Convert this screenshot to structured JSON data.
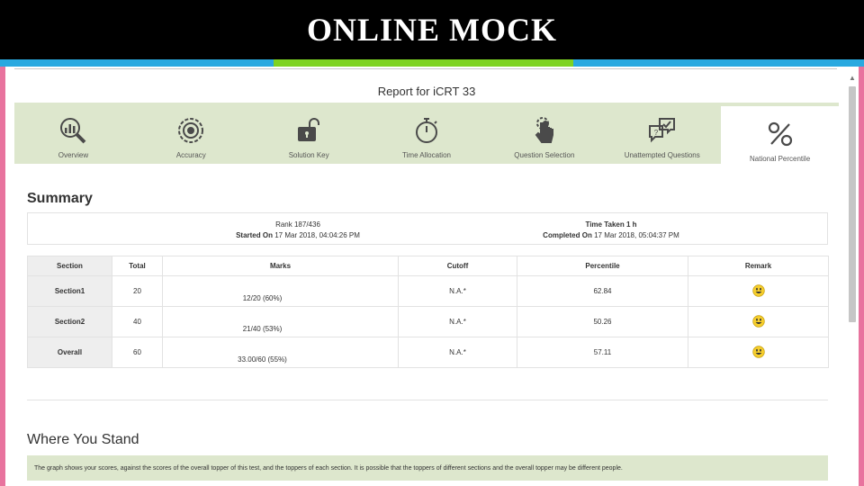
{
  "banner": {
    "title": "ONLINE MOCK"
  },
  "accent_colors": [
    "#29a9e0",
    "#29a9e0",
    "#7ed321",
    "#29a9e0"
  ],
  "report": {
    "title": "Report for iCRT 33"
  },
  "tabs": [
    {
      "label": "Overview",
      "icon": "analytics-magnifier-icon"
    },
    {
      "label": "Accuracy",
      "icon": "target-icon"
    },
    {
      "label": "Solution Key",
      "icon": "unlock-icon"
    },
    {
      "label": "Time Allocation",
      "icon": "stopwatch-icon"
    },
    {
      "label": "Question Selection",
      "icon": "pointer-hand-icon"
    },
    {
      "label": "Unattempted Questions",
      "icon": "chat-question-icon"
    },
    {
      "label": "National Percentile",
      "icon": "percent-icon"
    }
  ],
  "summary": {
    "title": "Summary",
    "rank_label": "Rank 187/436",
    "started_label": "Started On",
    "started_value": "17 Mar 2018, 04:04:26 PM",
    "time_taken_label": "Time Taken 1 h",
    "completed_label": "Completed On",
    "completed_value": "17 Mar 2018, 05:04:37 PM"
  },
  "table": {
    "headers": [
      "Section",
      "Total",
      "Marks",
      "Cutoff",
      "Percentile",
      "Remark"
    ],
    "rows": [
      {
        "section": "Section1",
        "total": "20",
        "marks": "12/20 (60%)",
        "cutoff": "N.A.*",
        "percentile": "62.84",
        "remark": "smiley-icon"
      },
      {
        "section": "Section2",
        "total": "40",
        "marks": "21/40 (53%)",
        "cutoff": "N.A.*",
        "percentile": "50.26",
        "remark": "smiley-icon"
      },
      {
        "section": "Overall",
        "total": "60",
        "marks": "33.00/60 (55%)",
        "cutoff": "N.A.*",
        "percentile": "57.11",
        "remark": "smiley-icon"
      }
    ]
  },
  "where_you_stand": {
    "title": "Where You Stand",
    "note": "The graph shows your scores, against the scores of the overall topper of this test, and the toppers of each section. It is possible that the toppers of different sections and the overall topper may be different people."
  }
}
